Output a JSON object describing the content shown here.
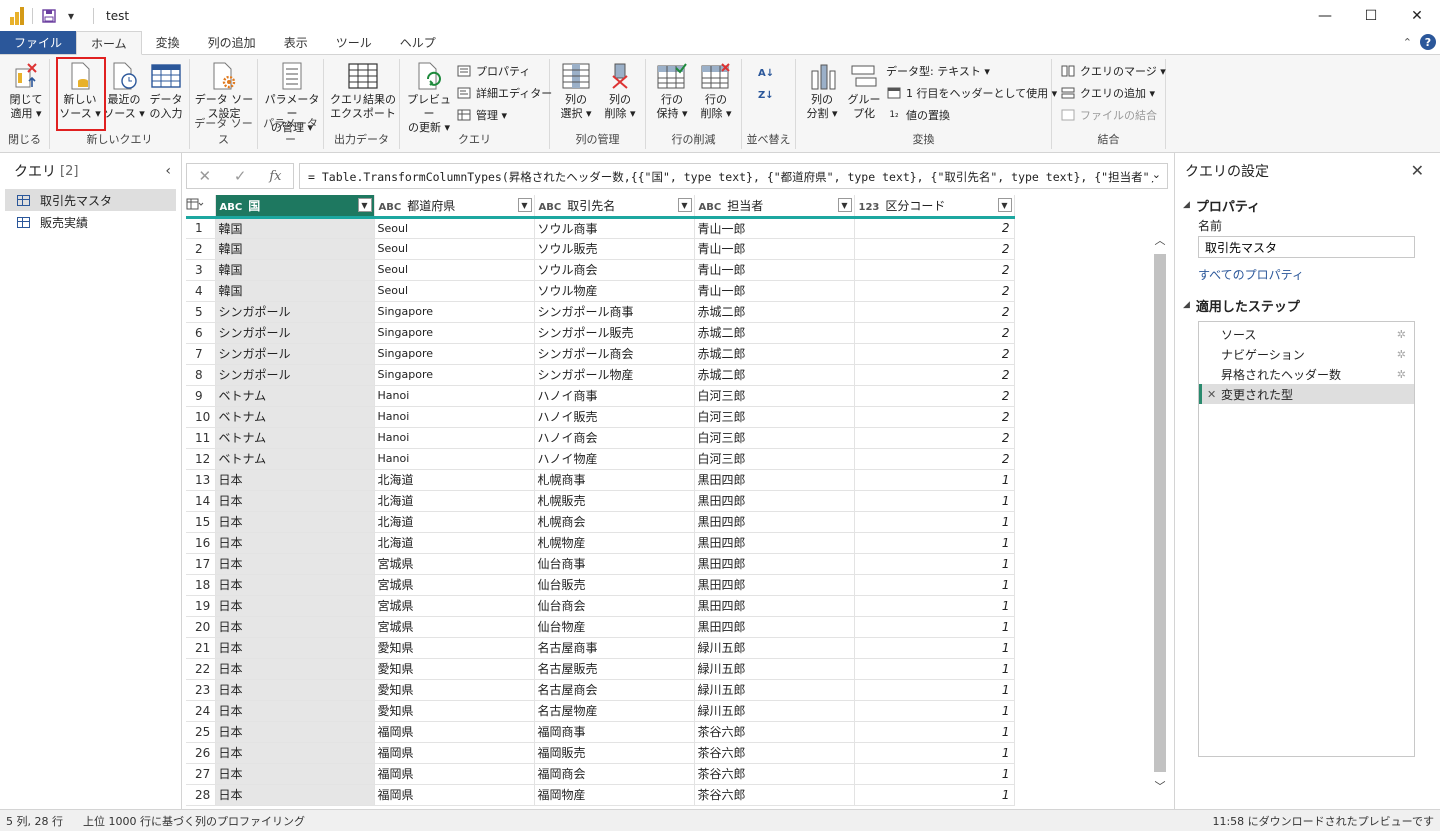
{
  "window": {
    "title": "test",
    "minimize": "—",
    "maximize": "☐",
    "close": "✕"
  },
  "tabs": [
    {
      "label": "ファイル"
    },
    {
      "label": "ホーム"
    },
    {
      "label": "変換"
    },
    {
      "label": "列の追加"
    },
    {
      "label": "表示"
    },
    {
      "label": "ツール"
    },
    {
      "label": "ヘルプ"
    }
  ],
  "ribbon": {
    "close_apply": {
      "line1": "閉じて",
      "line2": "適用 ▾"
    },
    "new_source": {
      "line1": "新しい",
      "line2": "ソース ▾"
    },
    "recent_sources": {
      "line1": "最近の",
      "line2": "ソース ▾"
    },
    "enter_data": {
      "line1": "データ",
      "line2": "の入力"
    },
    "data_source_settings": {
      "line1": "データ ソー",
      "line2": "ス設定"
    },
    "manage_parameters": {
      "line1": "パラメーター",
      "line2": "の管理 ▾"
    },
    "export_query": {
      "line1": "クエリ結果の",
      "line2": "エクスポート"
    },
    "refresh_preview": {
      "line1": "プレビュー",
      "line2": "の更新 ▾"
    },
    "properties": "プロパティ",
    "advanced_editor": "詳細エディター",
    "manage": "管理 ▾",
    "choose_columns": {
      "line1": "列の",
      "line2": "選択 ▾"
    },
    "remove_columns": {
      "line1": "列の",
      "line2": "削除 ▾"
    },
    "keep_rows": {
      "line1": "行の",
      "line2": "保持 ▾"
    },
    "remove_rows": {
      "line1": "行の",
      "line2": "削除 ▾"
    },
    "split_column": {
      "line1": "列の",
      "line2": "分割 ▾"
    },
    "group_by": {
      "line1": "グルー",
      "line2": "プ化"
    },
    "data_type": "データ型: テキスト ▾",
    "use_first_row": "1 行目をヘッダーとして使用 ▾",
    "replace_values": "値の置換",
    "merge_queries": "クエリのマージ ▾",
    "append_queries": "クエリの追加 ▾",
    "combine_files": "ファイルの結合",
    "groups": {
      "close": "閉じる",
      "new_query": "新しいクエリ",
      "data_sources": "データ ソース",
      "parameters": "パラメーター",
      "output_data": "出力データ",
      "query": "クエリ",
      "manage_columns": "列の管理",
      "reduce_rows": "行の削減",
      "sort": "並べ替え",
      "transform": "変換",
      "combine": "結合"
    }
  },
  "queries_panel": {
    "title": "クエリ",
    "count": "[2]",
    "items": [
      {
        "label": "取引先マスタ"
      },
      {
        "label": "販売実績"
      }
    ]
  },
  "formula": {
    "cancel": "✕",
    "apply": "✓",
    "fx": "fx",
    "text": "= Table.TransformColumnTypes(昇格されたヘッダー数,{{\"国\", type text}, {\"都道府県\", type text}, {\"取引先名\", type text}, {\"担当者\","
  },
  "table": {
    "columns": [
      {
        "type": "ABC",
        "name": "国"
      },
      {
        "type": "ABC",
        "name": "都道府県"
      },
      {
        "type": "ABC",
        "name": "取引先名"
      },
      {
        "type": "ABC",
        "name": "担当者"
      },
      {
        "type": "123",
        "name": "区分コード"
      }
    ],
    "rows": [
      [
        "1",
        "韓国",
        "Seoul",
        "ソウル商事",
        "青山一郎",
        "2"
      ],
      [
        "2",
        "韓国",
        "Seoul",
        "ソウル販売",
        "青山一郎",
        "2"
      ],
      [
        "3",
        "韓国",
        "Seoul",
        "ソウル商会",
        "青山一郎",
        "2"
      ],
      [
        "4",
        "韓国",
        "Seoul",
        "ソウル物産",
        "青山一郎",
        "2"
      ],
      [
        "5",
        "シンガポール",
        "Singapore",
        "シンガポール商事",
        "赤城二郎",
        "2"
      ],
      [
        "6",
        "シンガポール",
        "Singapore",
        "シンガポール販売",
        "赤城二郎",
        "2"
      ],
      [
        "7",
        "シンガポール",
        "Singapore",
        "シンガポール商会",
        "赤城二郎",
        "2"
      ],
      [
        "8",
        "シンガポール",
        "Singapore",
        "シンガポール物産",
        "赤城二郎",
        "2"
      ],
      [
        "9",
        "ベトナム",
        "Hanoi",
        "ハノイ商事",
        "白河三郎",
        "2"
      ],
      [
        "10",
        "ベトナム",
        "Hanoi",
        "ハノイ販売",
        "白河三郎",
        "2"
      ],
      [
        "11",
        "ベトナム",
        "Hanoi",
        "ハノイ商会",
        "白河三郎",
        "2"
      ],
      [
        "12",
        "ベトナム",
        "Hanoi",
        "ハノイ物産",
        "白河三郎",
        "2"
      ],
      [
        "13",
        "日本",
        "北海道",
        "札幌商事",
        "黒田四郎",
        "1"
      ],
      [
        "14",
        "日本",
        "北海道",
        "札幌販売",
        "黒田四郎",
        "1"
      ],
      [
        "15",
        "日本",
        "北海道",
        "札幌商会",
        "黒田四郎",
        "1"
      ],
      [
        "16",
        "日本",
        "北海道",
        "札幌物産",
        "黒田四郎",
        "1"
      ],
      [
        "17",
        "日本",
        "宮城県",
        "仙台商事",
        "黒田四郎",
        "1"
      ],
      [
        "18",
        "日本",
        "宮城県",
        "仙台販売",
        "黒田四郎",
        "1"
      ],
      [
        "19",
        "日本",
        "宮城県",
        "仙台商会",
        "黒田四郎",
        "1"
      ],
      [
        "20",
        "日本",
        "宮城県",
        "仙台物産",
        "黒田四郎",
        "1"
      ],
      [
        "21",
        "日本",
        "愛知県",
        "名古屋商事",
        "緑川五郎",
        "1"
      ],
      [
        "22",
        "日本",
        "愛知県",
        "名古屋販売",
        "緑川五郎",
        "1"
      ],
      [
        "23",
        "日本",
        "愛知県",
        "名古屋商会",
        "緑川五郎",
        "1"
      ],
      [
        "24",
        "日本",
        "愛知県",
        "名古屋物産",
        "緑川五郎",
        "1"
      ],
      [
        "25",
        "日本",
        "福岡県",
        "福岡商事",
        "茶谷六郎",
        "1"
      ],
      [
        "26",
        "日本",
        "福岡県",
        "福岡販売",
        "茶谷六郎",
        "1"
      ],
      [
        "27",
        "日本",
        "福岡県",
        "福岡商会",
        "茶谷六郎",
        "1"
      ],
      [
        "28",
        "日本",
        "福岡県",
        "福岡物産",
        "茶谷六郎",
        "1"
      ]
    ]
  },
  "settings_panel": {
    "title": "クエリの設定",
    "properties_heading": "プロパティ",
    "name_label": "名前",
    "name_value": "取引先マスタ",
    "all_properties_link": "すべてのプロパティ",
    "steps_heading": "適用したステップ",
    "steps": [
      {
        "label": "ソース"
      },
      {
        "label": "ナビゲーション"
      },
      {
        "label": "昇格されたヘッダー数"
      },
      {
        "label": "変更された型"
      }
    ]
  },
  "status": {
    "columns_rows": "5 列, 28 行",
    "profiling": "上位 1000 行に基づく列のプロファイリング",
    "preview": "11:58 にダウンロードされたプレビューです"
  },
  "colors": {
    "accent": "#2b579a",
    "column_selected": "#1e7860",
    "highlight_box": "#e02020",
    "quality_bar": "#1ca7a0"
  }
}
